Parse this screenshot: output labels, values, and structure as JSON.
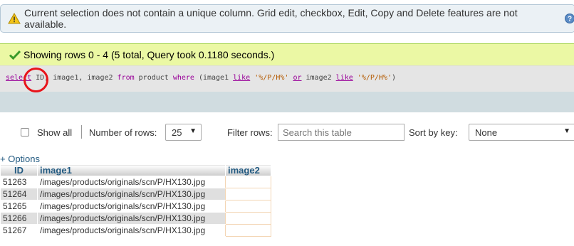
{
  "warning": {
    "text": "Current selection does not contain a unique column. Grid edit, checkbox, Edit, Copy and Delete features are not available.",
    "icon": "warning-icon",
    "help_icon": "help-icon"
  },
  "success": {
    "text": "Showing rows 0 - 4 (5 total, Query took 0.1180 seconds.)",
    "icon": "check-icon"
  },
  "sql": {
    "select_kw": "select",
    "cols": " ID, image1, image2 ",
    "from_kw": "from",
    "table": " product ",
    "where_kw": "where",
    "open": " (image1 ",
    "like1": "like",
    "pat1": "'%/P/H%'",
    "or_kw": "or",
    "image2": " image2 ",
    "like2": "like",
    "pat2": "'%/P/H%'",
    "close": ")"
  },
  "nav": {
    "show_all_label": "Show all",
    "rows_label": "Number of rows:",
    "rows_value": "25",
    "filter_label": "Filter rows:",
    "filter_placeholder": "Search this table",
    "sort_label": "Sort by key:",
    "sort_value": "None"
  },
  "options_link": "+ Options",
  "table": {
    "headers": [
      "ID",
      "image1",
      "image2"
    ],
    "rows": [
      {
        "id": "51263",
        "image1": "/images/products/originals/scn/P/HX130.jpg",
        "image2": ""
      },
      {
        "id": "51264",
        "image1": "/images/products/originals/scn/P/HX130.jpg",
        "image2": ""
      },
      {
        "id": "51265",
        "image1": "/images/products/originals/scn/P/HX130.jpg",
        "image2": ""
      },
      {
        "id": "51266",
        "image1": "/images/products/originals/scn/P/HX130.jpg",
        "image2": ""
      },
      {
        "id": "51267",
        "image1": "/images/products/originals/scn/P/HX130.jpg",
        "image2": ""
      }
    ]
  },
  "colors": {
    "annotation_circle": "#e8141b",
    "success_bg": "#ebf8a4",
    "warning_bg": "#ebf1f5",
    "header_text": "#235a81"
  }
}
